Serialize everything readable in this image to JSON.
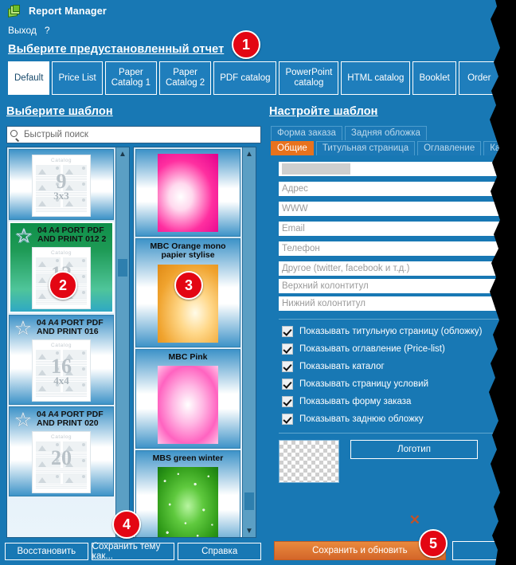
{
  "window": {
    "title": "Report Manager",
    "icon": "report-manager-icon"
  },
  "menu": {
    "logout": "Выход",
    "help": "?"
  },
  "preset_section": {
    "heading": "Выберите предустановленный отчет",
    "tabs": [
      {
        "label": "Default",
        "active": true
      },
      {
        "label": "Price List",
        "active": false
      },
      {
        "label": "Paper\nCatalog 1",
        "active": false
      },
      {
        "label": "Paper\nCatalog 2",
        "active": false
      },
      {
        "label": "PDF catalog",
        "active": false
      },
      {
        "label": "PowerPoint\ncatalog",
        "active": false
      },
      {
        "label": "HTML catalog",
        "active": false
      },
      {
        "label": "Booklet",
        "active": false
      },
      {
        "label": "Order",
        "active": false
      }
    ]
  },
  "left_panel": {
    "heading": "Выберите шаблон",
    "search": {
      "placeholder": "Быстрый поиск",
      "value": "",
      "icon": "search-icon"
    },
    "column1": [
      {
        "label": "",
        "selected": false,
        "thumb": {
          "caption": "Catalog",
          "number": "9",
          "grid": "3x3"
        }
      },
      {
        "label": "04 A4 PORT PDF AND PRINT 012 2",
        "selected": true,
        "star": true,
        "thumb": {
          "caption": "Catalog",
          "number": "12",
          "grid": "4x3"
        }
      },
      {
        "label": "04 A4 PORT PDF AND PRINT 016",
        "selected": false,
        "star": true,
        "thumb": {
          "caption": "Catalog",
          "number": "16",
          "grid": "4x4"
        }
      },
      {
        "label": "04 A4 PORT PDF AND PRINT 020",
        "selected": false,
        "star": true,
        "thumb": {
          "caption": "Catalog",
          "number": "20",
          "grid": ""
        }
      }
    ],
    "column2": [
      {
        "label": "",
        "swatch": "pink"
      },
      {
        "label": "MBC Orange mono papier stylise",
        "swatch": "orange"
      },
      {
        "label": "MBC Pink",
        "swatch": "pink2"
      },
      {
        "label": "MBS green winter",
        "swatch": "green"
      }
    ],
    "buttons": {
      "restore": "Восстановить",
      "save_theme_as": "Сохранить тему как...",
      "help": "Справка"
    }
  },
  "right_panel": {
    "heading": "Настройте шаблон",
    "tabs_row1": [
      {
        "label": "Форма заказа",
        "active": false
      },
      {
        "label": "Задняя обложка",
        "active": false
      }
    ],
    "tabs_row2": [
      {
        "label": "Общие",
        "active": true
      },
      {
        "label": "Титульная страница",
        "active": false
      },
      {
        "label": "Оглавление",
        "active": false
      },
      {
        "label": "Каталог",
        "active": false
      }
    ],
    "fields": [
      {
        "name": "company",
        "placeholder": "",
        "value": "",
        "masked": true
      },
      {
        "name": "address",
        "placeholder": "Адрес",
        "value": ""
      },
      {
        "name": "www",
        "placeholder": "WWW",
        "value": ""
      },
      {
        "name": "email",
        "placeholder": "Email",
        "value": ""
      },
      {
        "name": "phone",
        "placeholder": "Телефон",
        "value": ""
      },
      {
        "name": "other",
        "placeholder": "Другое (twitter, facebook и т.д.)",
        "value": ""
      },
      {
        "name": "header",
        "placeholder": "Верхний колонтитул",
        "value": ""
      },
      {
        "name": "footer",
        "placeholder": "Нижний колонтитул",
        "value": ""
      }
    ],
    "checkboxes": [
      {
        "label": "Показывать титульную страницу (обложку)",
        "checked": true
      },
      {
        "label": "Показывать оглавление (Price-list)",
        "checked": true
      },
      {
        "label": "Показывать каталог",
        "checked": true
      },
      {
        "label": "Показывать страницу условий",
        "checked": true
      },
      {
        "label": "Показывать форму заказа",
        "checked": true
      },
      {
        "label": "Показывать заднюю обложку",
        "checked": true
      }
    ],
    "logo": {
      "button_label": "Логотип",
      "preview": "empty-transparent",
      "remove_icon": "x-icon"
    },
    "save_button": "Сохранить и обновить",
    "extra_button": ""
  },
  "callouts": [
    {
      "id": "1",
      "number": "1"
    },
    {
      "id": "2",
      "number": "2"
    },
    {
      "id": "3",
      "number": "3"
    },
    {
      "id": "4",
      "number": "4"
    },
    {
      "id": "5",
      "number": "5"
    }
  ],
  "colors": {
    "background_blue": "#1878b4",
    "accent_orange": "#e8721d",
    "callout_red": "#e30613",
    "selected_green": "#1e9a55"
  }
}
